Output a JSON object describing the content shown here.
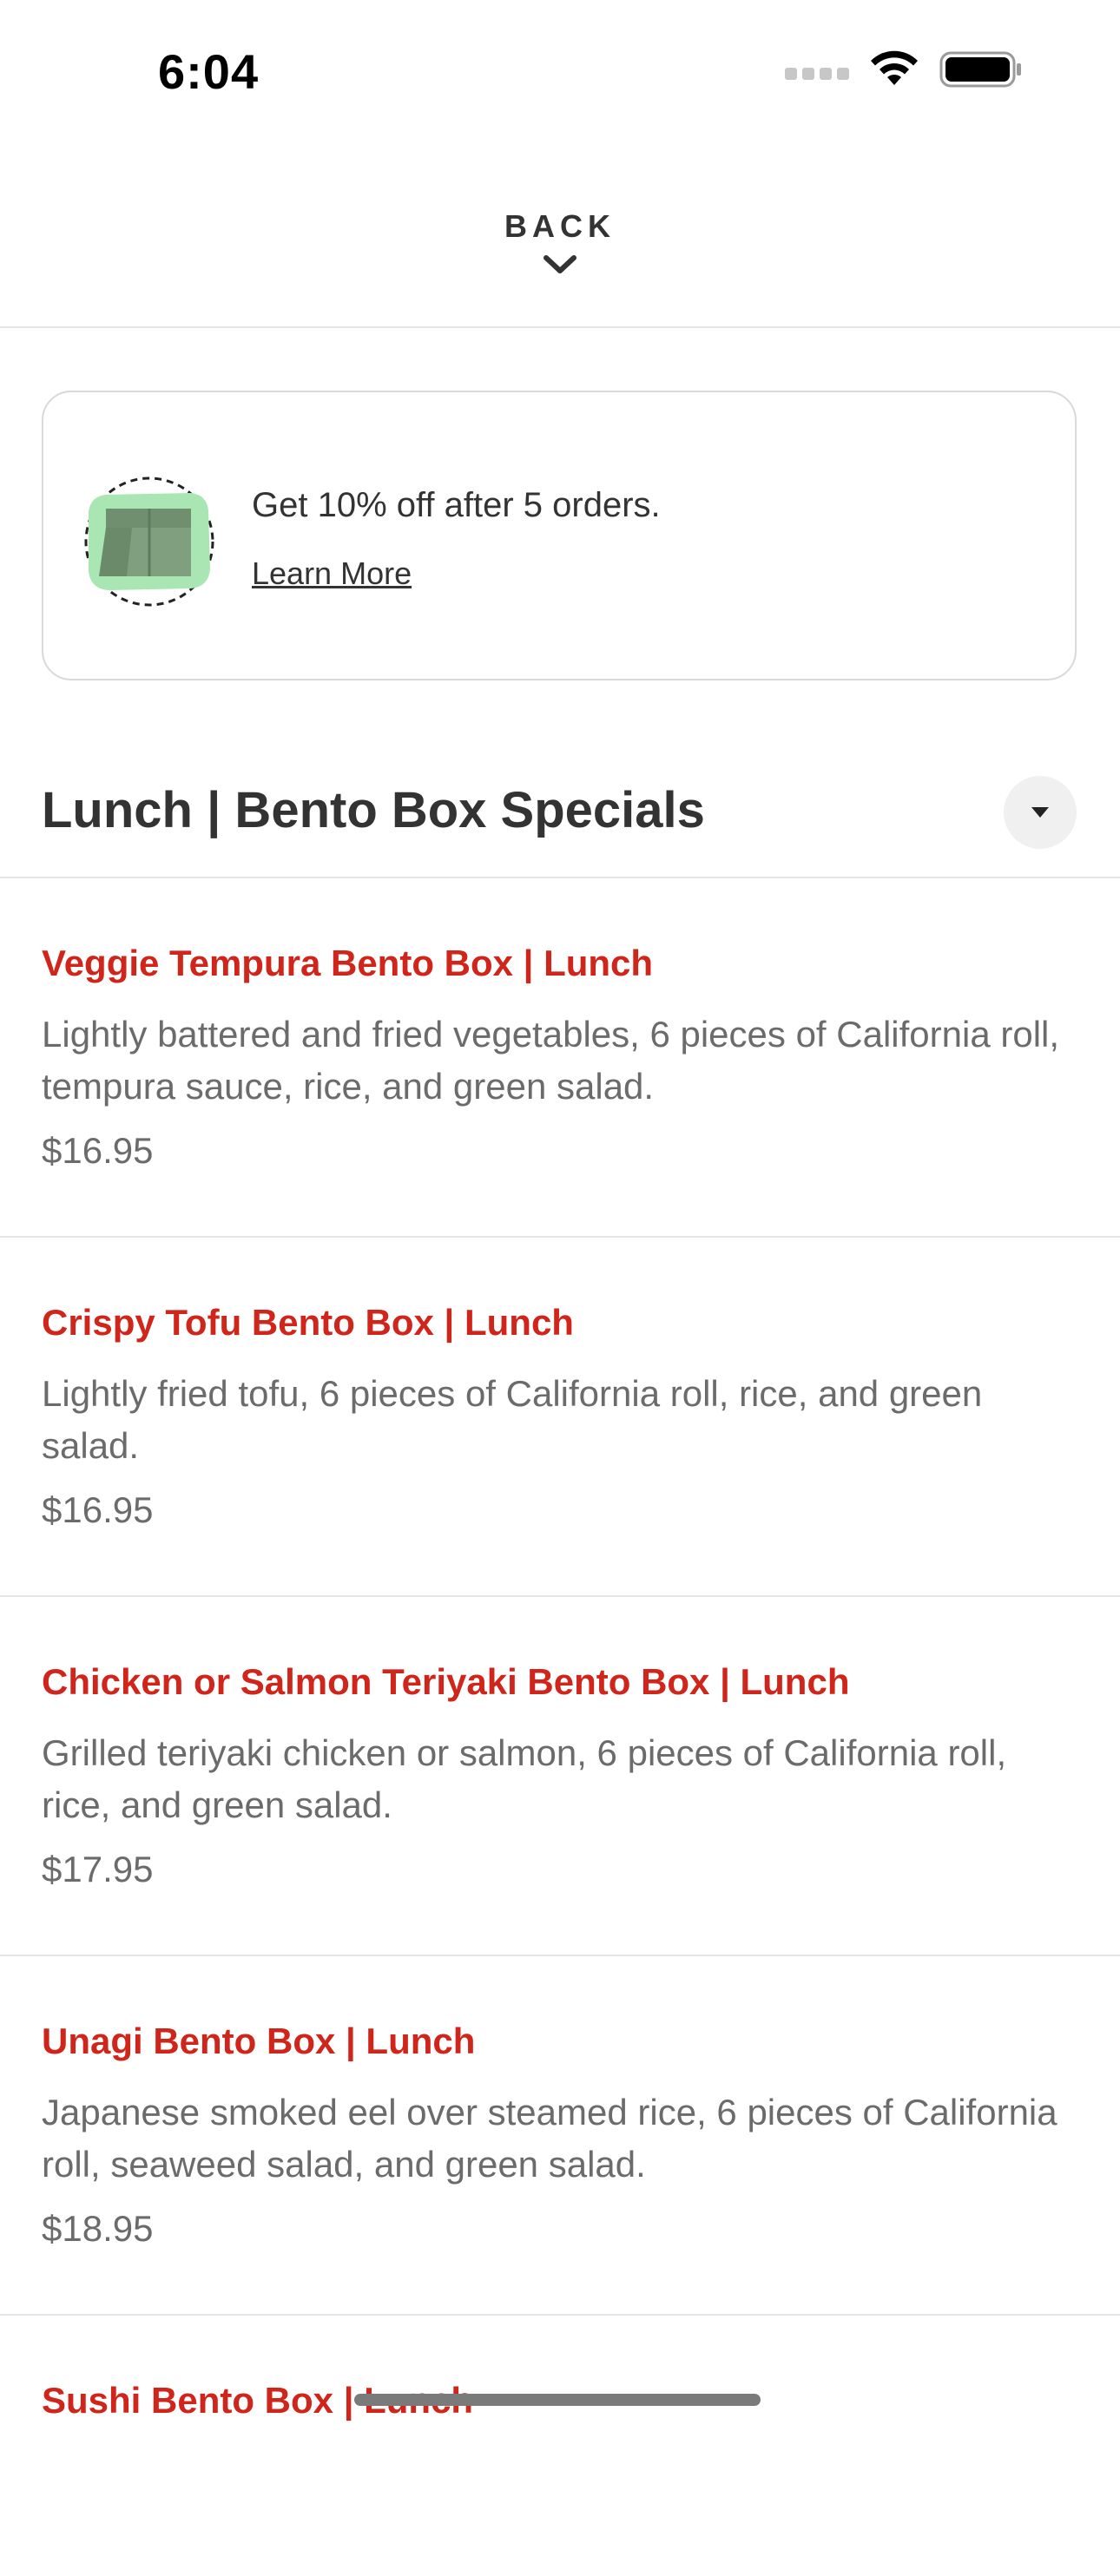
{
  "status_bar": {
    "time": "6:04"
  },
  "header": {
    "back_label": "BACK"
  },
  "promo": {
    "text": "Get 10% off after 5 orders.",
    "link": "Learn More"
  },
  "section": {
    "title": "Lunch | Bento Box Specials"
  },
  "colors": {
    "accent_red": "#d0251b",
    "text_dark": "#333333",
    "text_gray": "#6b6b6b",
    "divider": "#e6e6e6",
    "promo_green": "#a9e6b4"
  },
  "icons": {
    "back": "chevron-down-icon",
    "section_toggle": "triangle-down-icon",
    "promo": "bento-box-icon",
    "wifi": "wifi-icon",
    "battery": "battery-icon",
    "signal": "signal-icon"
  },
  "menu": {
    "items": [
      {
        "name": "Veggie Tempura Bento Box | Lunch",
        "description": "Lightly battered and fried vegetables, 6 pieces of California roll, tempura sauce, rice, and green salad.",
        "price": "$16.95"
      },
      {
        "name": "Crispy Tofu Bento Box | Lunch",
        "description": "Lightly fried tofu, 6 pieces of California roll, rice, and green salad.",
        "price": "$16.95"
      },
      {
        "name": "Chicken or Salmon Teriyaki Bento Box | Lunch",
        "description": "Grilled teriyaki chicken or salmon, 6 pieces of California roll, rice, and green salad.",
        "price": "$17.95"
      },
      {
        "name": "Unagi Bento Box | Lunch",
        "description": "Japanese smoked eel over steamed rice, 6 pieces of California roll, seaweed salad, and green salad.",
        "price": "$18.95"
      },
      {
        "name": "Sushi Bento Box | Lunch"
      }
    ]
  }
}
